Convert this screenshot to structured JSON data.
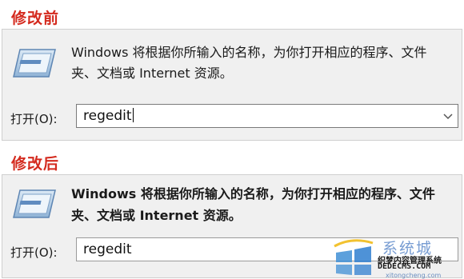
{
  "before": {
    "heading": "修改前",
    "description": "Windows 将根据你所输入的名称，为你打开相应的程序、文件夹、文档或 Internet 资源。",
    "open_label": "打开(O):",
    "input_value": "regedit",
    "dropdown_icon": "chevron-down-icon"
  },
  "after": {
    "heading": "修改后",
    "description": "Windows 将根据你所输入的名称，为你打开相应的程序、文件夹、文档或 Internet 资源。",
    "open_label": "打开(O):",
    "input_value": "regedit"
  },
  "watermark": {
    "title": "系统城",
    "subtitle": "织梦内容管理系统",
    "site": "DEDECMS.COM",
    "site2": "xitongcheng.com"
  },
  "colors": {
    "heading": "#d42a1e",
    "panel_bg": "#f0f0f0",
    "input_border": "#7a7a7a"
  }
}
